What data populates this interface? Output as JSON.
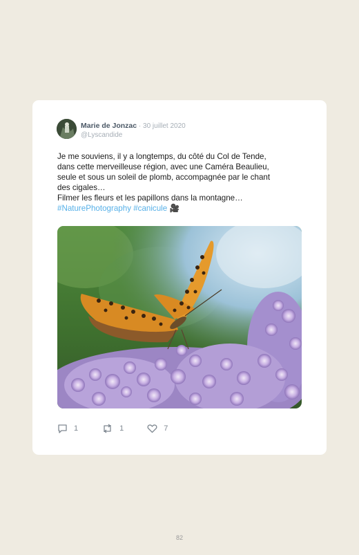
{
  "tweet": {
    "display_name": "Marie de Jonzac",
    "separator": " · ",
    "date": "30 juillet 2020",
    "handle": "@Lyscandide",
    "body": "Je me souviens, il y a longtemps, du côté du Col de Tende,\ndans cette merveilleuse région, avec une Caméra Beaulieu,\nseule et sous un soleil de plomb, accompagnée par le chant\ndes cigales…\nFilmer les fleurs et les papillons dans la montagne…\n",
    "hashtags": "#NaturePhotography #canicule",
    "emoji": "🎥",
    "replies": "1",
    "retweets": "1",
    "likes": "7"
  },
  "page_number": "82",
  "colors": {
    "background": "#efebe1",
    "card": "#ffffff",
    "hashtag": "#56b0e8",
    "name": "#4b5866",
    "muted": "#a6aeb6"
  },
  "icons": [
    "reply-icon",
    "retweet-icon",
    "like-icon",
    "camera-icon"
  ]
}
